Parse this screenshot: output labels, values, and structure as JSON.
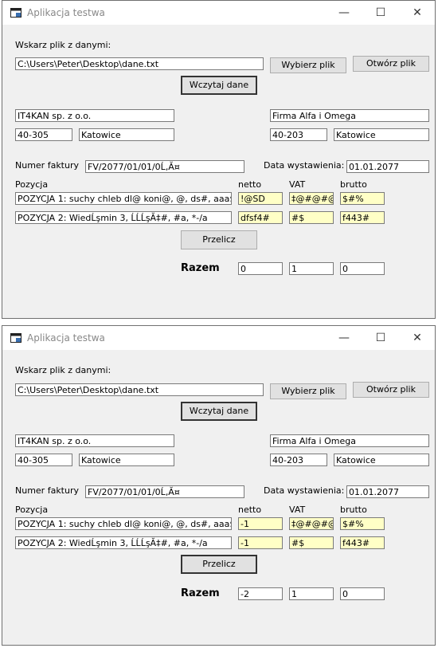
{
  "windows": [
    {
      "title": "Aplikacja testwa",
      "file_label": "Wskarz plik z danymi:",
      "file_path": "C:\\Users\\Peter\\Desktop\\dane.txt",
      "choose_btn": "Wybierz plik",
      "open_btn": "Otwórz plik",
      "load_btn": "Wczytaj dane",
      "seller_name": "IT4KAN sp. z o.o.",
      "seller_zip": "40-305",
      "seller_city": "Katowice",
      "buyer_name": "Firma Alfa i Omega",
      "buyer_zip": "40-203",
      "buyer_city": "Katowice",
      "invoice_label": "Numer faktury",
      "invoice_no": "FV/2077/01/01/0Ĺ‚Ă¤",
      "date_label": "Data wystawienia:",
      "date": "01.01.2077",
      "col_pos": "Pozycja",
      "col_netto": "netto",
      "col_vat": "VAT",
      "col_brutto": "brutto",
      "rows": [
        {
          "pos": "POZYCJA 1: suchy chleb dl@ koni@, @, ds#, aaa$",
          "netto": "!@SD",
          "vat": "‡@#@#@",
          "brutto": "$#%"
        },
        {
          "pos": "POZYCJA 2: WiedĹşmin 3, ĹĹĹşĂ‡#, #a, *-/a",
          "netto": "dfsf4#",
          "vat": "#$",
          "brutto": "f443#"
        }
      ],
      "calc_btn": "Przelicz",
      "total_label": "Razem",
      "total_netto": "0",
      "total_vat": "1",
      "total_brutto": "0"
    },
    {
      "title": "Aplikacja testwa",
      "file_label": "Wskarz plik z danymi:",
      "file_path": "C:\\Users\\Peter\\Desktop\\dane.txt",
      "choose_btn": "Wybierz plik",
      "open_btn": "Otwórz plik",
      "load_btn": "Wczytaj dane",
      "seller_name": "IT4KAN sp. z o.o.",
      "seller_zip": "40-305",
      "seller_city": "Katowice",
      "buyer_name": "Firma Alfa i Omega",
      "buyer_zip": "40-203",
      "buyer_city": "Katowice",
      "invoice_label": "Numer faktury",
      "invoice_no": "FV/2077/01/01/0Ĺ‚Ă¤",
      "date_label": "Data wystawienia:",
      "date": "01.01.2077",
      "col_pos": "Pozycja",
      "col_netto": "netto",
      "col_vat": "VAT",
      "col_brutto": "brutto",
      "rows": [
        {
          "pos": "POZYCJA 1: suchy chleb dl@ koni@, @, ds#, aaa$",
          "netto": "-1",
          "vat": "‡@#@#@",
          "brutto": "$#%"
        },
        {
          "pos": "POZYCJA 2: WiedĹşmin 3, ĹĹĹşĂ‡#, #a, *-/a",
          "netto": "-1",
          "vat": "#$",
          "brutto": "f443#"
        }
      ],
      "calc_btn": "Przelicz",
      "total_label": "Razem",
      "total_netto": "-2",
      "total_vat": "1",
      "total_brutto": "0"
    }
  ],
  "icons": [
    "app-icon",
    "minimize-icon",
    "maximize-icon",
    "close-icon"
  ],
  "colors": {
    "field_highlight": "#ffffc6",
    "window_bg": "#f0f0f0"
  }
}
